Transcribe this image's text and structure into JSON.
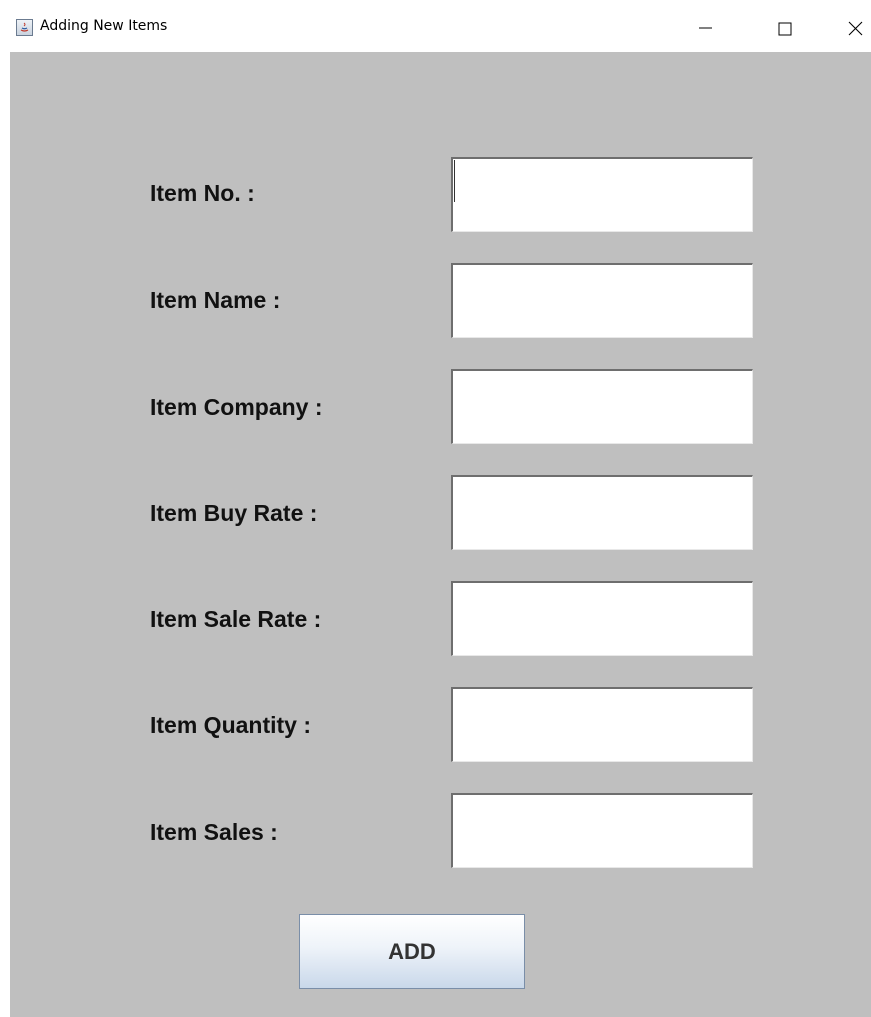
{
  "window": {
    "title": "Adding New Items",
    "icon": "java-app-icon",
    "controls": [
      "minimize-icon",
      "maximize-icon",
      "close-icon"
    ]
  },
  "form": {
    "fields": [
      {
        "label": "Item No. :",
        "value": ""
      },
      {
        "label": "Item Name :",
        "value": ""
      },
      {
        "label": "Item Company :",
        "value": ""
      },
      {
        "label": "Item Buy Rate :",
        "value": ""
      },
      {
        "label": "Item Sale Rate :",
        "value": ""
      },
      {
        "label": "Item Quantity :",
        "value": ""
      },
      {
        "label": "Item Sales :",
        "value": ""
      }
    ],
    "submit_label": "ADD"
  },
  "colors": {
    "panel_background": "#bfbfbf",
    "titlebar_background": "#ffffff",
    "button_gradient_bottom": "#c9d8ea"
  }
}
